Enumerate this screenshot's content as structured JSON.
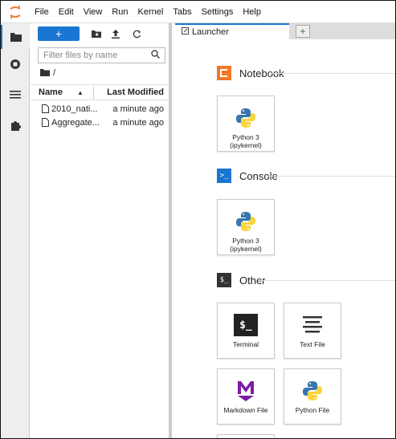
{
  "menubar": {
    "items": [
      "File",
      "Edit",
      "View",
      "Run",
      "Kernel",
      "Tabs",
      "Settings",
      "Help"
    ]
  },
  "filebrowser": {
    "search_placeholder": "Filter files by name",
    "breadcrumb": "/",
    "columns": {
      "name": "Name",
      "modified": "Last Modified"
    },
    "files": [
      {
        "name": "2010_nati...",
        "modified": "a minute ago"
      },
      {
        "name": "Aggregate...",
        "modified": "a minute ago"
      }
    ]
  },
  "main": {
    "tab_label": "Launcher",
    "tab_add": "+"
  },
  "launcher": {
    "sections": [
      {
        "title": "Notebook",
        "cards": [
          {
            "label": "Python 3\n(ipykernel)"
          }
        ]
      },
      {
        "title": "Console",
        "cards": [
          {
            "label": "Python 3\n(ipykernel)"
          }
        ]
      },
      {
        "title": "Other",
        "cards": [
          {
            "label": "Terminal"
          },
          {
            "label": "Text File"
          },
          {
            "label": "Markdown File"
          },
          {
            "label": "Python File"
          }
        ]
      }
    ]
  },
  "colors": {
    "accent": "#1976d2",
    "notebook_orange": "#f37726",
    "console_blue": "#1976d2",
    "markdown_purple": "#7b1fa2"
  }
}
